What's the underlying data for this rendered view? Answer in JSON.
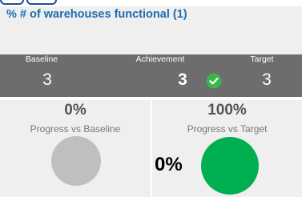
{
  "header": {
    "title": "% # of warehouses functional (1)"
  },
  "stats": {
    "baseline_label": "Baseline",
    "baseline_value": "3",
    "achievement_label": "Achievement",
    "achievement_value": "3",
    "target_label": "Target",
    "target_value": "3"
  },
  "progress": {
    "baseline": {
      "percent_text": "0%",
      "caption": "Progress vs Baseline"
    },
    "target": {
      "percent_text": "100%",
      "caption": "Progress vs Target",
      "overlay_percent_text": "0%"
    }
  },
  "icons": {
    "status": "check-circle-icon"
  },
  "colors": {
    "title_blue": "#1e6db3",
    "band_grey": "#6d6d6d",
    "panel_bg": "#efefef",
    "baseline_circle": "#bfbfbf",
    "target_circle": "#00b050",
    "check_green": "#3cb54a"
  }
}
